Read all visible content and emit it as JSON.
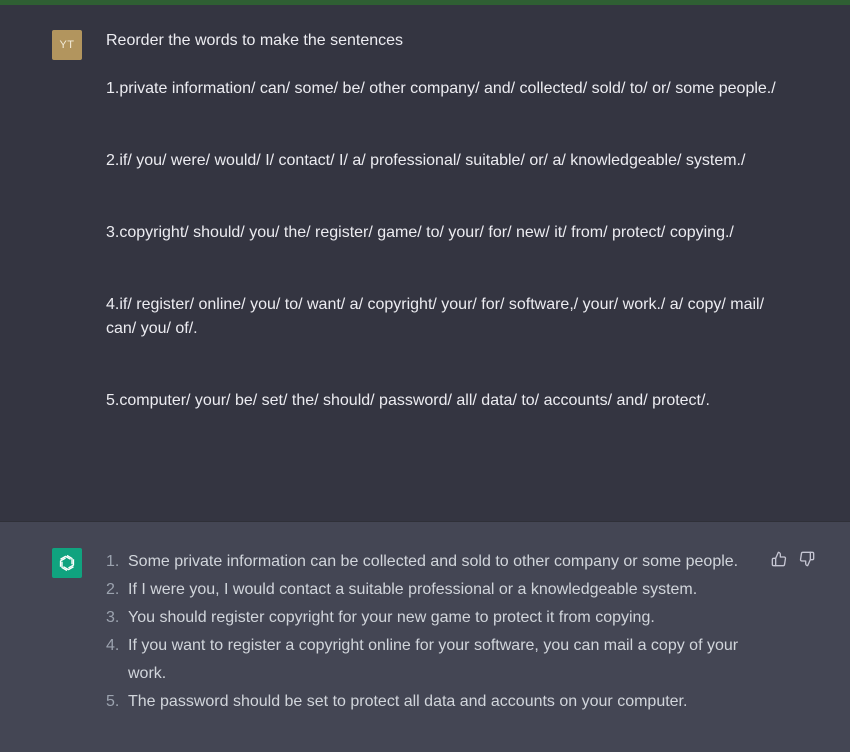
{
  "user": {
    "avatar_initials": "YT",
    "avatar_color": "#b2955e",
    "intro": "Reorder the words to make the sentences",
    "questions": [
      "1.private information/ can/ some/ be/ other company/ and/ collected/ sold/ to/ or/ some people./",
      "2.if/ you/ were/ would/ I/ contact/ I/ a/ professional/ suitable/ or/ a/ knowledgeable/ system./",
      "3.copyright/ should/ you/ the/ register/ game/ to/ your/ for/ new/ it/ from/ protect/ copying./",
      "4.if/ register/ online/ you/ to/ want/ a/ copyright/ your/ for/ software,/ your/ work./ a/ copy/ mail/ can/ you/ of/.",
      "5.computer/ your/ be/ set/ the/ should/ password/ all/ data/ to/ accounts/ and/ protect/."
    ]
  },
  "assistant": {
    "avatar_icon": "openai-logo-icon",
    "avatar_color": "#10a37f",
    "answers": [
      {
        "num": "1.",
        "text": "Some private information can be collected and sold to other company or some people."
      },
      {
        "num": "2.",
        "text": "If I were you, I would contact a suitable professional or a knowledgeable system."
      },
      {
        "num": "3.",
        "text": "You should register copyright for your new game to protect it from copying."
      },
      {
        "num": "4.",
        "text": "If you want to register a copyright online for your software, you can mail a copy of your work."
      },
      {
        "num": "5.",
        "text": "The password should be set to protect all data and accounts on your computer."
      }
    ],
    "feedback_icons": [
      "thumbs-up-icon",
      "thumbs-down-icon"
    ]
  },
  "colors": {
    "background": "#343541",
    "assistant_background": "#444654",
    "top_bar": "#2f5f33"
  }
}
